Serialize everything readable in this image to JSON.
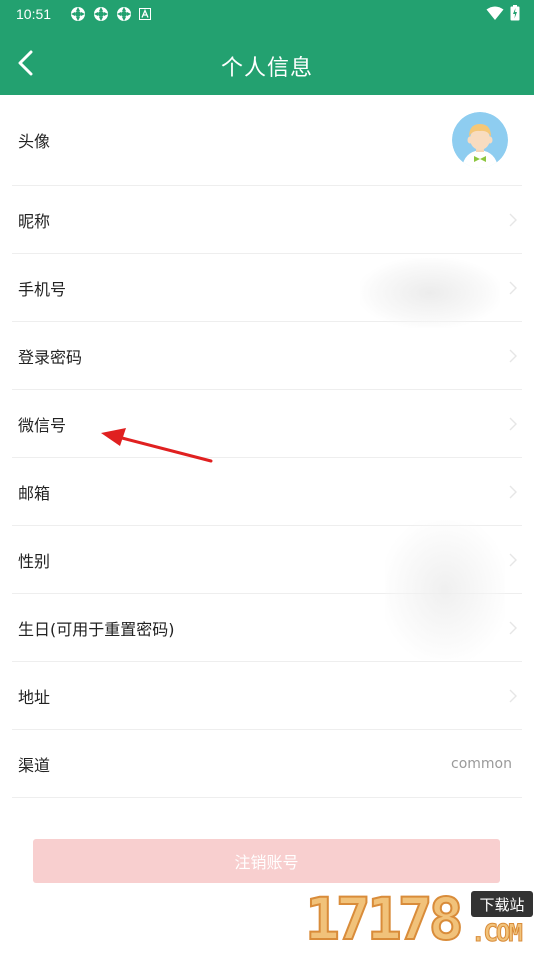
{
  "status_bar": {
    "time": "10:51"
  },
  "header": {
    "title": "个人信息"
  },
  "rows": [
    {
      "label": "头像",
      "value": ""
    },
    {
      "label": "昵称",
      "value": ""
    },
    {
      "label": "手机号",
      "value": ""
    },
    {
      "label": "登录密码",
      "value": ""
    },
    {
      "label": "微信号",
      "value": ""
    },
    {
      "label": "邮箱",
      "value": ""
    },
    {
      "label": "性别",
      "value": ""
    },
    {
      "label": "生日(可用于重置密码)",
      "value": ""
    },
    {
      "label": "地址",
      "value": ""
    },
    {
      "label": "渠道",
      "value": "common"
    }
  ],
  "cancel_button": {
    "label": "注销账号"
  },
  "watermark": {
    "number": "17178",
    "tag": "下载站",
    "com": ".COM"
  },
  "colors": {
    "header": "#23a170",
    "cancel_bg": "#f8cfcf",
    "arrow": "#e02020"
  },
  "icons": [
    "back-arrow-icon",
    "chevron-right-icon",
    "avatar-icon",
    "wifi-icon",
    "battery-icon"
  ]
}
